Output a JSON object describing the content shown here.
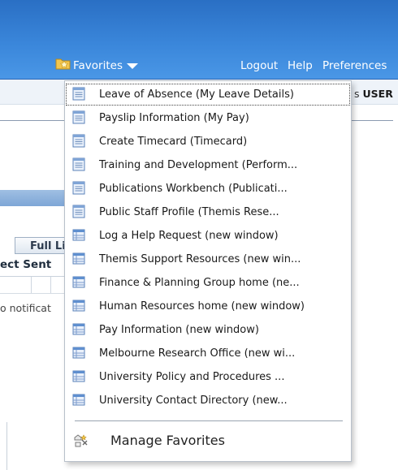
{
  "header": {
    "favorites_label": "Favorites",
    "logout": "Logout",
    "help": "Help",
    "preferences": "Preferences"
  },
  "strip": {
    "user_prefix": "s ",
    "user_bold": "USER"
  },
  "background": {
    "full_list_button": "Full Li",
    "column_header": "ect Sent",
    "notification_text": "o notificat"
  },
  "menu": {
    "items": [
      {
        "label": "Leave of Absence (My Leave Details)",
        "icon": "page-icon"
      },
      {
        "label": "Payslip Information (My Pay)",
        "icon": "page-icon"
      },
      {
        "label": "Create Timecard (Timecard)",
        "icon": "page-icon"
      },
      {
        "label": "Training and Development (Perform...",
        "icon": "page-icon"
      },
      {
        "label": "Publications Workbench (Publicati...",
        "icon": "page-icon"
      },
      {
        "label": "Public Staff Profile (Themis Rese...",
        "icon": "page-icon"
      },
      {
        "label": "Log a Help Request (new window)",
        "icon": "window-icon"
      },
      {
        "label": "Themis Support Resources (new win...",
        "icon": "window-icon"
      },
      {
        "label": "Finance & Planning Group home (ne...",
        "icon": "window-icon"
      },
      {
        "label": "Human Resources home (new window)",
        "icon": "window-icon"
      },
      {
        "label": "Pay Information (new window)",
        "icon": "window-icon"
      },
      {
        "label": "Melbourne Research Office (new wi...",
        "icon": "window-icon"
      },
      {
        "label": "University Policy and Procedures ...",
        "icon": "window-icon"
      },
      {
        "label": "University Contact Directory (new...",
        "icon": "window-icon"
      }
    ],
    "manage_label": "Manage Favorites"
  }
}
